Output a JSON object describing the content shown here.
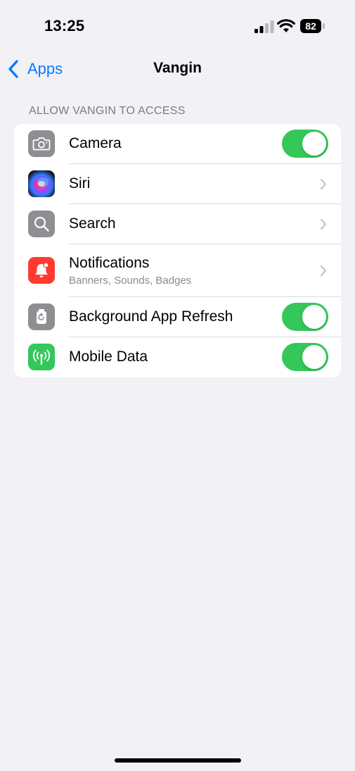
{
  "status_bar": {
    "time": "13:25",
    "battery_percent": "82",
    "signal_icon": "cellular-signal-icon",
    "wifi_icon": "wifi-icon"
  },
  "nav": {
    "back_label": "Apps",
    "title": "Vangin"
  },
  "section": {
    "header": "ALLOW VANGIN TO ACCESS"
  },
  "rows": [
    {
      "label": "Camera",
      "icon": "camera-icon",
      "icon_color": "#8e8e93",
      "control": "toggle",
      "toggle_on": true
    },
    {
      "label": "Siri",
      "icon": "siri-icon",
      "control": "chevron"
    },
    {
      "label": "Search",
      "icon": "search-icon",
      "icon_color": "#8e8e93",
      "control": "chevron"
    },
    {
      "label": "Notifications",
      "sublabel": "Banners, Sounds, Badges",
      "icon": "notifications-icon",
      "icon_color": "#ff3b30",
      "control": "chevron"
    },
    {
      "label": "Background App Refresh",
      "icon": "background-refresh-icon",
      "icon_color": "#8e8e93",
      "control": "toggle",
      "toggle_on": true
    },
    {
      "label": "Mobile Data",
      "icon": "antenna-icon",
      "icon_color": "#34c759",
      "control": "toggle",
      "toggle_on": true
    }
  ],
  "colors": {
    "accent": "#0a7aff",
    "toggle_on": "#34c759",
    "background": "#f2f1f6"
  }
}
